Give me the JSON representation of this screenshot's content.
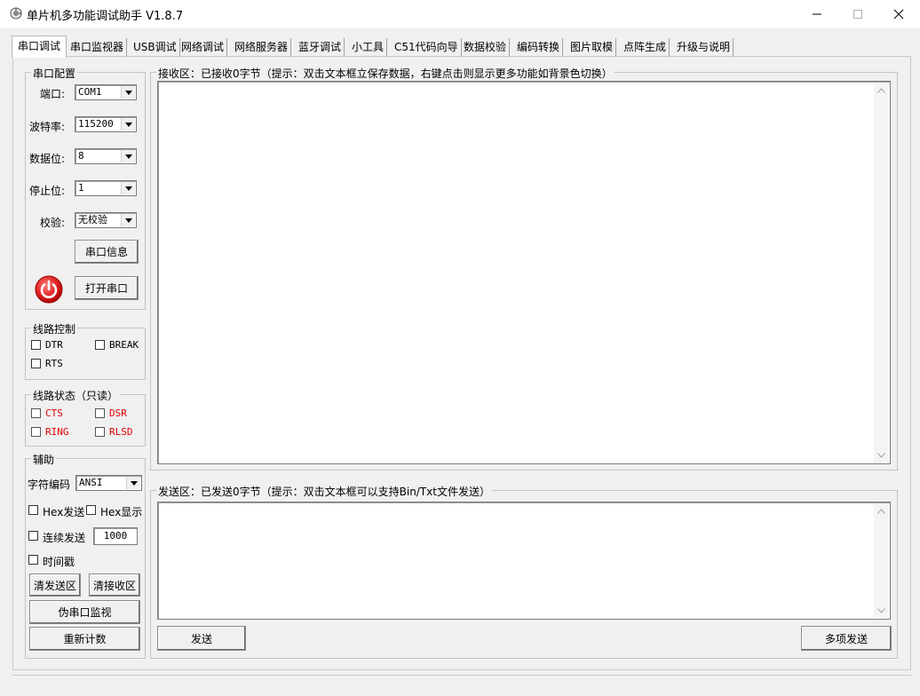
{
  "window": {
    "title": "单片机多功能调试助手 V1.8.7"
  },
  "tabs": [
    {
      "label": "串口调试"
    },
    {
      "label": "串口监视器"
    },
    {
      "label": "USB调试"
    },
    {
      "label": "网络调试"
    },
    {
      "label": "网络服务器"
    },
    {
      "label": "蓝牙调试"
    },
    {
      "label": "小工具"
    },
    {
      "label": "C51代码向导"
    },
    {
      "label": "数据校验"
    },
    {
      "label": "编码转换"
    },
    {
      "label": "图片取模"
    },
    {
      "label": "点阵生成"
    },
    {
      "label": "升级与说明"
    }
  ],
  "serial_config": {
    "title": "串口配置",
    "port_label": "端口:",
    "port_value": "COM1",
    "baud_label": "波特率:",
    "baud_value": "115200",
    "databits_label": "数据位:",
    "databits_value": "8",
    "stopbits_label": "停止位:",
    "stopbits_value": "1",
    "parity_label": "校验:",
    "parity_value": "无校验",
    "info_button": "串口信息",
    "open_button": "打开串口"
  },
  "line_control": {
    "title": "线路控制",
    "dtr": "DTR",
    "break": "BREAK",
    "rts": "RTS"
  },
  "line_status": {
    "title": "线路状态（只读）",
    "cts": "CTS",
    "dsr": "DSR",
    "ring": "RING",
    "rlsd": "RLSD"
  },
  "aux": {
    "title": "辅助",
    "encoding_label": "字符编码",
    "encoding_value": "ANSI",
    "hex_send": "Hex发送",
    "hex_display": "Hex显示",
    "continuous_send": "连续发送",
    "interval_value": "1000",
    "timestamp": "时间戳",
    "clear_send": "清发送区",
    "clear_receive": "清接收区",
    "fake_monitor": "伪串口监视",
    "reset_count": "重新计数"
  },
  "receive": {
    "title": "接收区：已接收0字节（提示：双击文本框立保存数据，右键点击则显示更多功能如背景色切换）"
  },
  "send": {
    "title": "发送区：已发送0字节（提示：双击文本框可以支持Bin/Txt文件发送）",
    "send_button": "发送",
    "multi_send_button": "多项发送"
  },
  "colors": {
    "status_red": "#e00000",
    "power_red": "#e02020"
  }
}
